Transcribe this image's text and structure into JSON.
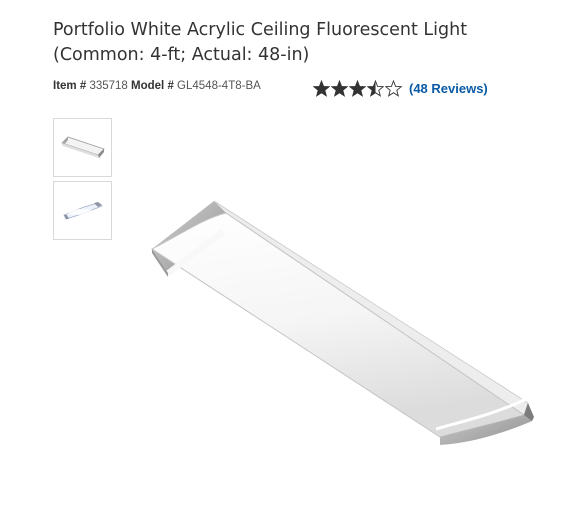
{
  "product": {
    "title_line1": "Portfolio White Acrylic Ceiling Fluorescent Light",
    "title_line2": "(Common: 4-ft; Actual: 48-in)",
    "item_label": "Item #",
    "item_number": "335718",
    "model_label": "Model #",
    "model_number": "GL4548-4T8-BA"
  },
  "rating": {
    "value": 3.5,
    "max": 5,
    "reviews_text": "(48 Reviews)",
    "star_color": "#333333"
  },
  "gallery": {
    "thumbnails": [
      {
        "name": "thumbnail-1",
        "icon": "light-fixture-angle-view"
      },
      {
        "name": "thumbnail-2",
        "icon": "light-fixture-lit-view"
      }
    ],
    "main_image": "fluorescent-light-fixture"
  }
}
